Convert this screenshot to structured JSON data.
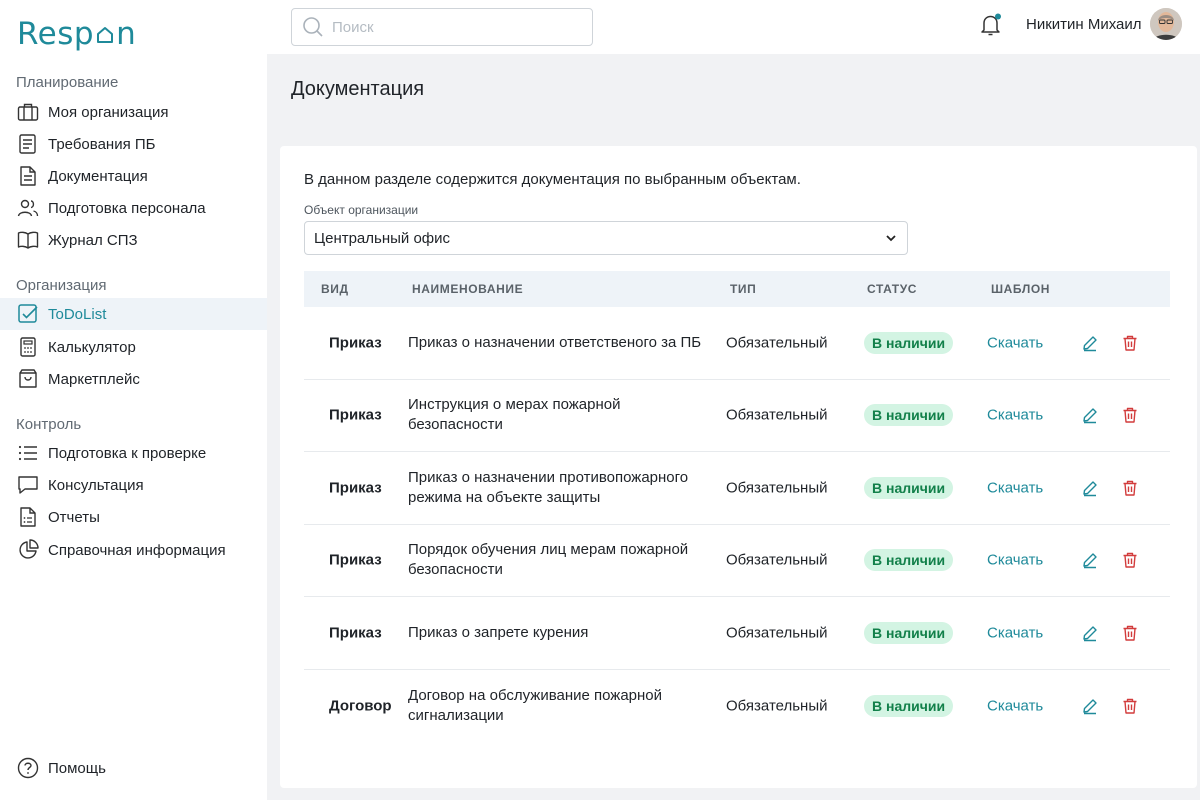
{
  "brand": {
    "logo_text_a": "Resp",
    "logo_text_b": "n",
    "accent": "#1f8a9a"
  },
  "search": {
    "placeholder": "Поиск"
  },
  "header": {
    "user_name": "Никитин Михаил"
  },
  "sidebar": {
    "sections": [
      {
        "title": "Планирование",
        "items": [
          {
            "label": "Моя организация",
            "icon": "briefcase-icon"
          },
          {
            "label": "Требования ПБ",
            "icon": "checklist-icon"
          },
          {
            "label": "Документация",
            "icon": "document-icon"
          },
          {
            "label": "Подготовка персонала",
            "icon": "users-icon"
          },
          {
            "label": "Журнал СПЗ",
            "icon": "book-icon"
          }
        ]
      },
      {
        "title": "Организация",
        "items": [
          {
            "label": "ToDoList",
            "icon": "checkbox-icon",
            "active": true
          },
          {
            "label": "Калькулятор",
            "icon": "calculator-icon"
          },
          {
            "label": "Маркетплейс",
            "icon": "shopping-bag-icon"
          }
        ]
      },
      {
        "title": "Контроль",
        "items": [
          {
            "label": "Подготовка к проверке",
            "icon": "list-icon"
          },
          {
            "label": "Консультация",
            "icon": "chat-icon"
          },
          {
            "label": "Отчеты",
            "icon": "report-icon"
          },
          {
            "label": "Справочная информация",
            "icon": "pie-chart-icon"
          }
        ]
      }
    ],
    "help_label": "Помощь"
  },
  "main": {
    "title": "Документация",
    "description": "В данном разделе содержится документация по выбранным объектам.",
    "object_label": "Объект организации",
    "object_value": "Центральный офис",
    "table": {
      "headers": {
        "kind": "ВИД",
        "name": "НАИМЕНОВАНИЕ",
        "type": "ТИП",
        "status": "СТАТУС",
        "template": "ШАБЛОН"
      },
      "rows": [
        {
          "kind": "Приказ",
          "name": "Приказ о назначении ответственого за ПБ",
          "type": "Обязательный",
          "status": "В наличии",
          "download": "Скачать"
        },
        {
          "kind": "Приказ",
          "name": "Инструкция о мерах пожарной безопасности",
          "type": "Обязательный",
          "status": "В наличии",
          "download": "Скачать"
        },
        {
          "kind": "Приказ",
          "name": "Приказ о назначении противопожарного режима на объекте защиты",
          "type": "Обязательный",
          "status": "В наличии",
          "download": "Скачать"
        },
        {
          "kind": "Приказ",
          "name": "Порядок обучения лиц мерам пожарной безопасности",
          "type": "Обязательный",
          "status": "В наличии",
          "download": "Скачать"
        },
        {
          "kind": "Приказ",
          "name": "Приказ о запрете курения",
          "type": "Обязательный",
          "status": "В наличии",
          "download": "Скачать"
        },
        {
          "kind": "Договор",
          "name": "Договор на обслуживание пожарной сигнализации",
          "type": "Обязательный",
          "status": "В наличии",
          "download": "Скачать"
        }
      ]
    }
  }
}
